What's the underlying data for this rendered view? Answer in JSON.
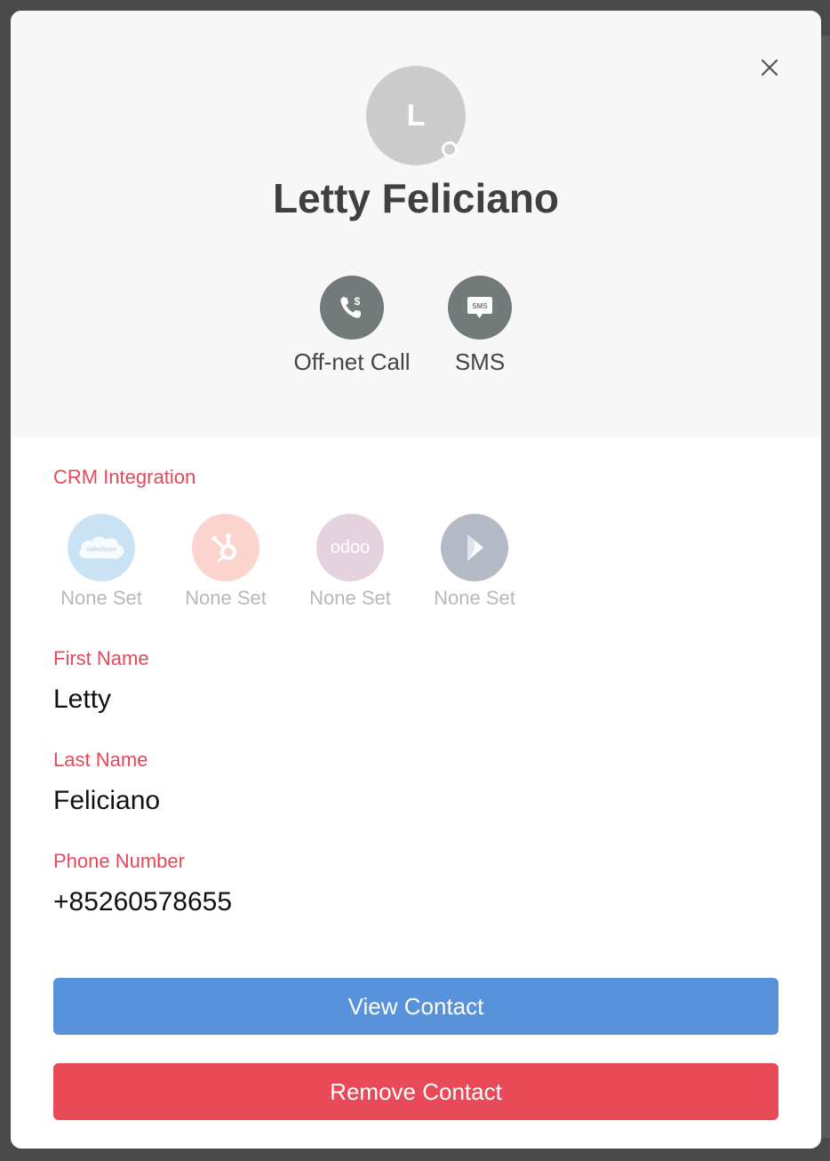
{
  "contact": {
    "avatar_initial": "L",
    "name": "Letty Feliciano"
  },
  "actions": [
    {
      "label": "Off-net Call",
      "icon": "phone-dollar-icon"
    },
    {
      "label": "SMS",
      "icon": "sms-bubble-icon",
      "icon_text": "SMS"
    }
  ],
  "crm": {
    "title": "CRM Integration",
    "items": [
      {
        "name": "salesforce",
        "logo_text": "salesforce",
        "status": "None Set",
        "color": "#c9e3f5"
      },
      {
        "name": "hubspot",
        "status": "None Set",
        "color": "#fbd5cd"
      },
      {
        "name": "odoo",
        "logo_text": "odoo",
        "status": "None Set",
        "color": "#e4d2de"
      },
      {
        "name": "dynamics",
        "status": "None Set",
        "color": "#b3bac6"
      }
    ]
  },
  "fields": {
    "first_name": {
      "label": "First Name",
      "value": "Letty"
    },
    "last_name": {
      "label": "Last Name",
      "value": "Feliciano"
    },
    "phone": {
      "label": "Phone Number",
      "value": "+85260578655"
    }
  },
  "buttons": {
    "view": "View Contact",
    "remove": "Remove Contact"
  },
  "colors": {
    "accent_label": "#e5485a",
    "primary_button": "#5892db",
    "danger_button": "#e84a58",
    "action_circle": "#727a7a"
  }
}
